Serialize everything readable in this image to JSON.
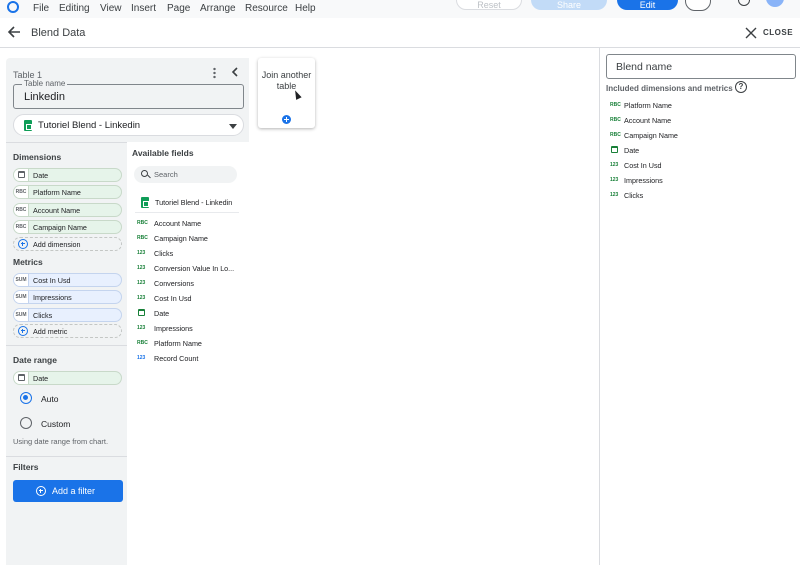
{
  "menubar": {
    "items": [
      "File",
      "Editing",
      "View",
      "Insert",
      "Page",
      "Arrange",
      "Resource",
      "Help"
    ],
    "reset_label": "Reset",
    "share_label": "Share",
    "edit_label": "Edit"
  },
  "header": {
    "title": "Blend Data",
    "close_label": "CLOSE"
  },
  "table": {
    "label": "Table 1",
    "name_label": "Table name",
    "name_value": "Linkedin",
    "source": "Tutoriel Blend - Linkedin",
    "dimensions_heading": "Dimensions",
    "dimensions": [
      {
        "type": "date",
        "name": "Date"
      },
      {
        "type": "RBC",
        "name": "Platform Name"
      },
      {
        "type": "RBC",
        "name": "Account Name"
      },
      {
        "type": "RBC",
        "name": "Campaign Name"
      }
    ],
    "add_dimension": "Add dimension",
    "metrics_heading": "Metrics",
    "metrics": [
      {
        "type": "SUM",
        "name": "Cost In Usd"
      },
      {
        "type": "SUM",
        "name": "Impressions"
      },
      {
        "type": "SUM",
        "name": "Clicks"
      }
    ],
    "add_metric": "Add metric",
    "date_range_heading": "Date range",
    "date_range_field": "Date",
    "date_range_options": [
      "Auto",
      "Custom"
    ],
    "date_range_selected": "Auto",
    "date_range_helper": "Using date range from chart.",
    "filters_heading": "Filters",
    "add_filter": "Add a filter"
  },
  "available_fields": {
    "heading": "Available fields",
    "search_placeholder": "Search",
    "source": "Tutoriel Blend - Linkedin",
    "fields": [
      {
        "type": "RBC",
        "name": "Account Name"
      },
      {
        "type": "RBC",
        "name": "Campaign Name"
      },
      {
        "type": "123",
        "name": "Clicks"
      },
      {
        "type": "123",
        "name": "Conversion Value In Lo..."
      },
      {
        "type": "123",
        "name": "Conversions"
      },
      {
        "type": "123",
        "name": "Cost In Usd"
      },
      {
        "type": "date",
        "name": "Date"
      },
      {
        "type": "123",
        "name": "Impressions"
      },
      {
        "type": "RBC",
        "name": "Platform Name"
      },
      {
        "type": "123",
        "name": "Record Count"
      }
    ]
  },
  "join_card": {
    "label": "Join another table"
  },
  "right_panel": {
    "blend_name_placeholder": "Blend name",
    "included_heading": "Included dimensions and metrics",
    "help_glyph": "?",
    "fields": [
      {
        "type": "RBC",
        "name": "Platform Name"
      },
      {
        "type": "RBC",
        "name": "Account Name"
      },
      {
        "type": "RBC",
        "name": "Campaign Name"
      },
      {
        "type": "date",
        "name": "Date"
      },
      {
        "type": "123",
        "name": "Cost In Usd"
      },
      {
        "type": "123",
        "name": "Impressions"
      },
      {
        "type": "123",
        "name": "Clicks"
      }
    ]
  },
  "colors": {
    "accent": "#1a73e8",
    "dimension_chip": "#e6f4ea",
    "metric_chip": "#e8f0fe",
    "panel_bg": "#f1f3f4",
    "sheets_green": "#0f9d58"
  }
}
